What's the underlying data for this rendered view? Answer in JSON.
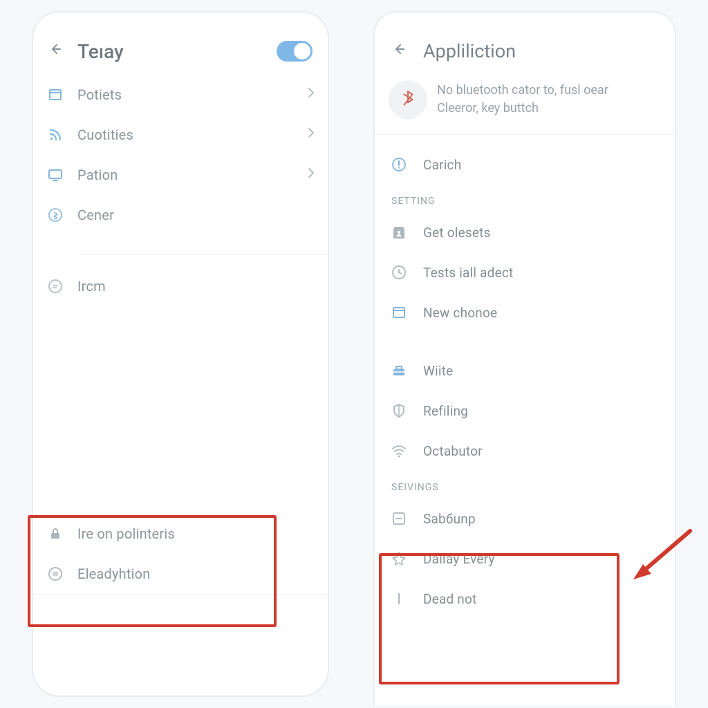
{
  "left": {
    "title": "Teıay",
    "toggle_on": true,
    "items": [
      {
        "label": "Potiets",
        "icon": "window-icon",
        "chevron": true
      },
      {
        "label": "Cuotities",
        "icon": "rss-icon",
        "chevron": true
      },
      {
        "label": "Pation",
        "icon": "display-icon",
        "chevron": true
      },
      {
        "label": "Cener",
        "icon": "bluetooth-ring-icon",
        "chevron": false
      }
    ],
    "item_single": {
      "label": "Ircm",
      "icon": "pass-ring-icon"
    },
    "bottom": [
      {
        "label": "Ire on polinteris",
        "icon": "lock-icon"
      },
      {
        "label": "Eleadyhtion",
        "icon": "equal-ring-icon"
      }
    ]
  },
  "right": {
    "title": "Appliliction",
    "banner": {
      "line1": "No bluetooth cator to, fusl oear",
      "line2": "Cleeror, key buttch"
    },
    "top_item": {
      "label": "Carich",
      "icon": "alert-ring-icon"
    },
    "section1_header": "SETTING",
    "section1": [
      {
        "label": "Get olesets",
        "icon": "person-tag-icon"
      },
      {
        "label": "Tests iall adect",
        "icon": "clock-ring-icon"
      },
      {
        "label": "New chonoe",
        "icon": "window-icon"
      }
    ],
    "section_loose": [
      {
        "label": "Wiite",
        "icon": "toolbox-icon"
      },
      {
        "label": "Refiling",
        "icon": "shield-icon"
      },
      {
        "label": "Octabutor",
        "icon": "wifi-icon"
      }
    ],
    "section2_header": "SEIVINGS",
    "section2": [
      {
        "label": "Sabбunp",
        "icon": "minus-box-icon"
      },
      {
        "label": "Dallay Every",
        "icon": "compass-icon"
      },
      {
        "label": "Dead not",
        "icon": "vbar-icon"
      }
    ]
  },
  "colors": {
    "accent": "#7fb8e6",
    "icon_blue": "#82b6de",
    "icon_grey": "#9aa2a8",
    "bt_red": "#d06a5f",
    "highlight_red": "#cf3a2c"
  }
}
